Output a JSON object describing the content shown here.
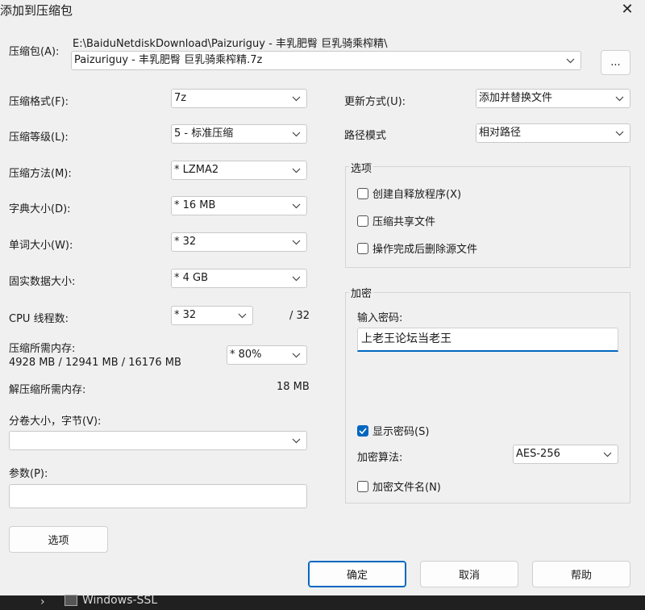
{
  "title": "添加到压缩包",
  "archive": {
    "label": "压缩包(A):",
    "path": "E:\\BaiduNetdiskDownload\\Paizuriguy - 丰乳肥臀 巨乳骑乘榨精\\",
    "filename": "Paizuriguy - 丰乳肥臀 巨乳骑乘榨精.7z",
    "browse_label": "..."
  },
  "left": {
    "format": {
      "label": "压缩格式(F):",
      "value": "7z"
    },
    "level": {
      "label": "压缩等级(L):",
      "value": "5 - 标准压缩"
    },
    "method": {
      "label": "压缩方法(M):",
      "value": "*  LZMA2"
    },
    "dict": {
      "label": "字典大小(D):",
      "value": "*  16 MB"
    },
    "word": {
      "label": "单词大小(W):",
      "value": "*  32"
    },
    "solid": {
      "label": "固实数据大小:",
      "value": "*  4 GB"
    },
    "threads": {
      "label": "CPU 线程数:",
      "value": "*  32",
      "max": "/ 32"
    },
    "mem": {
      "label": "压缩所需内存:",
      "detail": "4928 MB / 12941 MB / 16176 MB",
      "value": "*  80%"
    },
    "decomp": {
      "label": "解压缩所需内存:",
      "value": "18 MB"
    },
    "volume": {
      "label": "分卷大小，字节(V):",
      "value": ""
    },
    "params": {
      "label": "参数(P):",
      "value": ""
    },
    "options_button": "选项"
  },
  "right": {
    "update": {
      "label": "更新方式(U):",
      "value": "添加并替换文件"
    },
    "pathmode": {
      "label": "路径模式",
      "value": "相对路径"
    },
    "options": {
      "title": "选项",
      "sfx": "创建自释放程序(X)",
      "shared": "压缩共享文件",
      "delete": "操作完成后删除源文件"
    },
    "encryption": {
      "title": "加密",
      "password_label": "输入密码:",
      "password": "上老王论坛当老王",
      "show_password": "显示密码(S)",
      "method_label": "加密算法:",
      "method_value": "AES-256",
      "encrypt_names": "加密文件名(N)"
    }
  },
  "buttons": {
    "ok": "确定",
    "cancel": "取消",
    "help": "帮助"
  },
  "taskbar": {
    "app": "Windows-SSL"
  }
}
